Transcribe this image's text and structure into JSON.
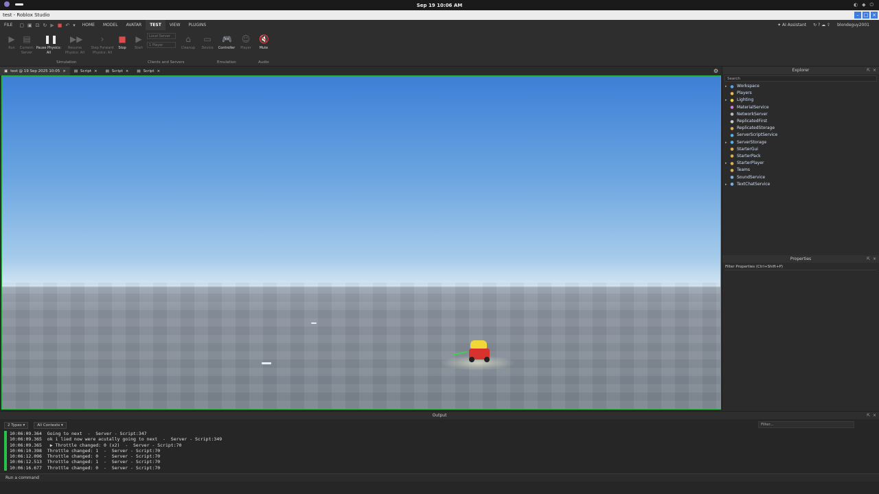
{
  "os": {
    "clock": "Sep 19  10:06 AM"
  },
  "window": {
    "title": "test - Roblox Studio"
  },
  "menu": {
    "items": [
      "FILE",
      "HOME",
      "MODEL",
      "AVATAR",
      "TEST",
      "VIEW",
      "PLUGINS"
    ],
    "active": "TEST",
    "ai_assistant": "AI Assistant",
    "username": "blondeguy2001"
  },
  "ribbon": {
    "buttons": [
      {
        "label": "Run",
        "sub": "",
        "enabled": false
      },
      {
        "label": "Current:",
        "sub": "Server",
        "enabled": false
      },
      {
        "label": "Pause Physics:",
        "sub": "All",
        "enabled": true
      },
      {
        "label": "Resume",
        "sub": "Physics: All",
        "enabled": false
      },
      {
        "label": "Step Forward",
        "sub": "Physics: All",
        "enabled": false
      },
      {
        "label": "Stop",
        "sub": "",
        "enabled": true
      },
      {
        "label": "Start",
        "sub": "",
        "enabled": false
      },
      {
        "label": "Cleanup",
        "sub": "",
        "enabled": false
      },
      {
        "label": "Device",
        "sub": "",
        "enabled": false
      },
      {
        "label": "Controller",
        "sub": "",
        "enabled": true
      },
      {
        "label": "Player",
        "sub": "",
        "enabled": false
      },
      {
        "label": "Mute",
        "sub": "",
        "enabled": true
      }
    ],
    "server_select": "Local Server",
    "player_select": "1 Player",
    "groups": [
      "Simulation",
      "Clients and Servers",
      "Emulation",
      "Audio"
    ]
  },
  "doc_tabs": [
    {
      "label": "test @ 19 Sep 2025 10:05",
      "active": true
    },
    {
      "label": "Script",
      "active": false
    },
    {
      "label": "Script",
      "active": false
    },
    {
      "label": "Script",
      "active": false
    }
  ],
  "explorer": {
    "title": "Explorer",
    "search_placeholder": "Search",
    "items": [
      {
        "label": "Workspace",
        "expandable": true,
        "icon": "globe-icon",
        "color": "#5aa0e8"
      },
      {
        "label": "Players",
        "expandable": false,
        "icon": "players-icon",
        "color": "#e8c04a"
      },
      {
        "label": "Lighting",
        "expandable": true,
        "icon": "bulb-icon",
        "color": "#f2d640"
      },
      {
        "label": "MaterialService",
        "expandable": false,
        "icon": "material-icon",
        "color": "#d07ad8"
      },
      {
        "label": "NetworkServer",
        "expandable": false,
        "icon": "network-icon",
        "color": "#bbbbbb"
      },
      {
        "label": "ReplicatedFirst",
        "expandable": false,
        "icon": "replicated-first-icon",
        "color": "#cccccc"
      },
      {
        "label": "ReplicatedStorage",
        "expandable": false,
        "icon": "folder-icon",
        "color": "#e0b050"
      },
      {
        "label": "ServerScriptService",
        "expandable": false,
        "icon": "script-service-icon",
        "color": "#5ab0e0"
      },
      {
        "label": "ServerStorage",
        "expandable": true,
        "icon": "storage-icon",
        "color": "#5ab0e0"
      },
      {
        "label": "StarterGui",
        "expandable": false,
        "icon": "gui-icon",
        "color": "#e0b050"
      },
      {
        "label": "StarterPack",
        "expandable": false,
        "icon": "pack-icon",
        "color": "#e0b050"
      },
      {
        "label": "StarterPlayer",
        "expandable": true,
        "icon": "player-icon",
        "color": "#e0b050"
      },
      {
        "label": "Teams",
        "expandable": false,
        "icon": "teams-icon",
        "color": "#e0b050"
      },
      {
        "label": "SoundService",
        "expandable": false,
        "icon": "sound-icon",
        "color": "#7ab0e8"
      },
      {
        "label": "TextChatService",
        "expandable": true,
        "icon": "chat-icon",
        "color": "#7ab0e8"
      }
    ]
  },
  "properties": {
    "title": "Properties",
    "filter_placeholder": "Filter Properties (Ctrl+Shift+P)"
  },
  "output": {
    "title": "Output",
    "types_dropdown": "2 Types",
    "contexts_dropdown": "All Contexts",
    "filter_placeholder": "Filter...",
    "lines": [
      "10:06:09.364  Going to next  -  Server - Script:347",
      "10:06:09.365  ok i lied now were acutally going to next  -  Server - Script:349",
      "10:06:09.365   ▶ Throttle changed: 0 (x2)  -  Server - Script:70",
      "10:06:10.398  Throttle changed: 1  -  Server - Script:70",
      "10:06:12.096  Throttle changed: 0  -  Server - Script:70",
      "10:06:12.513  Throttle changed: 1  -  Server - Script:70",
      "10:06:16.677  Throttle changed: 0  -  Server - Script:70"
    ],
    "command_placeholder": "Run a command"
  }
}
